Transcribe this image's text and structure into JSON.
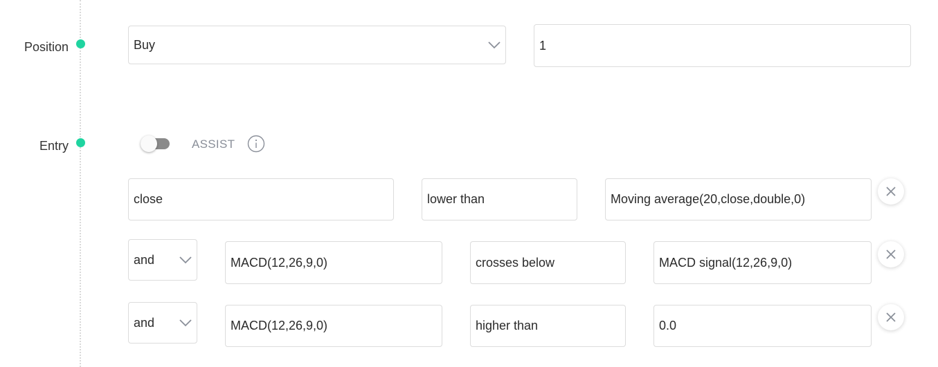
{
  "position": {
    "label": "Position",
    "direction": "Buy",
    "quantity": "1"
  },
  "entry": {
    "label": "Entry",
    "assist_label": "ASSIST",
    "assist_enabled": false,
    "conditions": [
      {
        "left": "close",
        "operator": "lower than",
        "right": "Moving average(20,close,double,0)"
      },
      {
        "join": "and",
        "left": "MACD(12,26,9,0)",
        "operator": "crosses below",
        "right": "MACD signal(12,26,9,0)"
      },
      {
        "join": "and",
        "left": "MACD(12,26,9,0)",
        "operator": "higher than",
        "right": "0.0"
      }
    ]
  },
  "icons": {
    "dropdown": "chevron-down-icon",
    "info": "info-icon",
    "remove": "close-icon"
  },
  "colors": {
    "accent": "#1fd4a0",
    "toggle_off": "#8a8a8a",
    "muted_text": "#8a8f99"
  }
}
